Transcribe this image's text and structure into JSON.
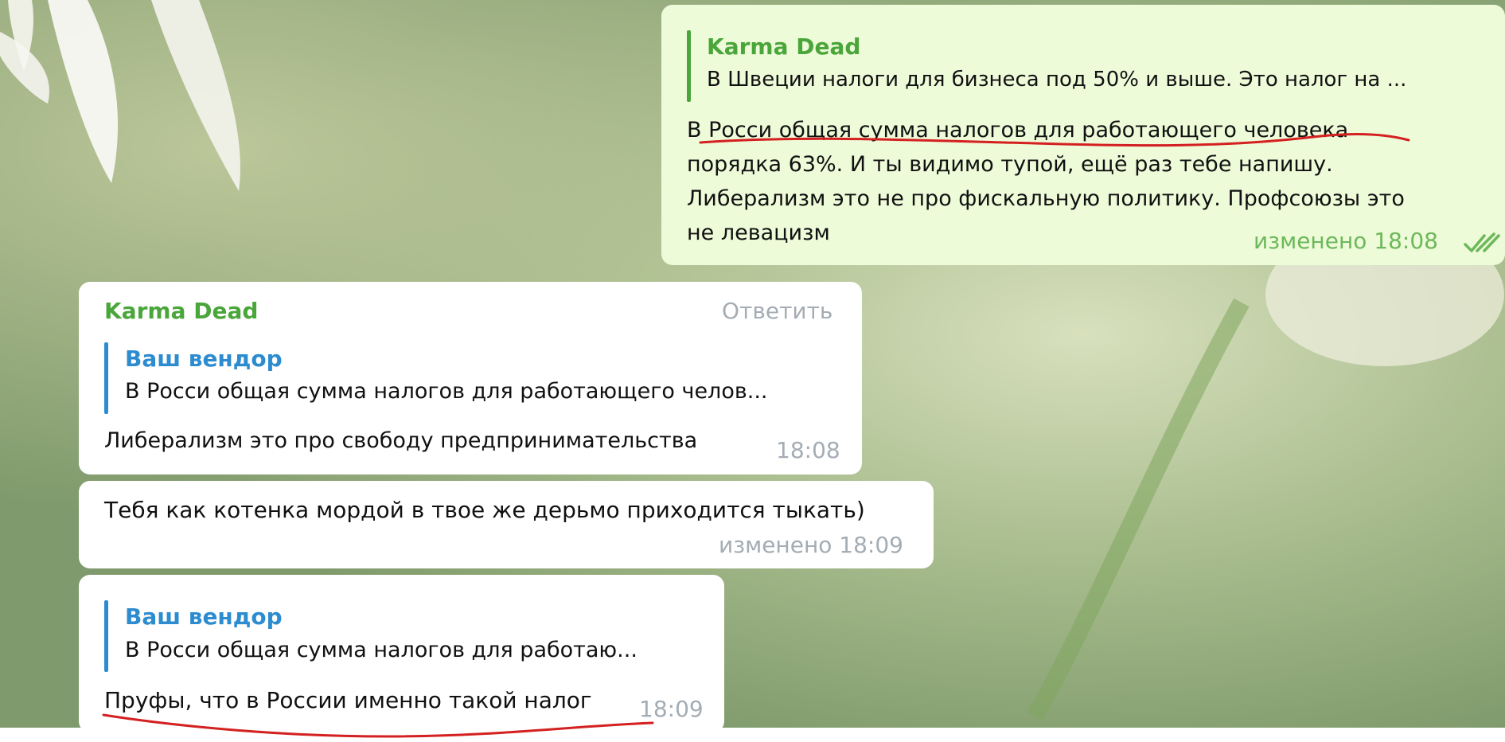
{
  "colors": {
    "outgoing_bubble": "#eefbd9",
    "incoming_bubble": "#ffffff",
    "name_green": "#4aa63a",
    "quote_blue": "#2d8ccf",
    "meta_gray": "#a4acb4",
    "meta_green": "#6cb85a",
    "underline_red": "#d42020"
  },
  "icons": {
    "read_receipt": "double-check-icon"
  },
  "messages": [
    {
      "direction": "outgoing",
      "reply": {
        "name": "Karma Dead",
        "text": "В Швеции налоги для бизнеса под 50% и выше. Это налог на ..."
      },
      "lines": [
        "В Росси общая сумма налогов для работающего человека",
        "порядка 63%. И ты видимо тупой, ещё раз тебе напишу.",
        "Либерализм это не про фискальную политику. Профсоюзы это",
        "не левацизм"
      ],
      "meta": "изменено 18:08"
    },
    {
      "direction": "incoming",
      "sender": "Karma Dead",
      "reply_button": "Ответить",
      "reply": {
        "name": "Ваш вендор",
        "text": "В Росси общая сумма налогов для работающего челов..."
      },
      "lines": [
        "Либерализм это про свободу предпринимательства"
      ],
      "meta": "18:08"
    },
    {
      "direction": "incoming",
      "lines": [
        "Тебя как котенка мордой в твое же дерьмо приходится тыкать)"
      ],
      "meta": "изменено 18:09"
    },
    {
      "direction": "incoming",
      "reply": {
        "name": "Ваш вендор",
        "text": "В Росси общая сумма налогов для работаю..."
      },
      "lines": [
        "Пруфы, что в России именно такой налог"
      ],
      "meta": "18:09"
    }
  ]
}
